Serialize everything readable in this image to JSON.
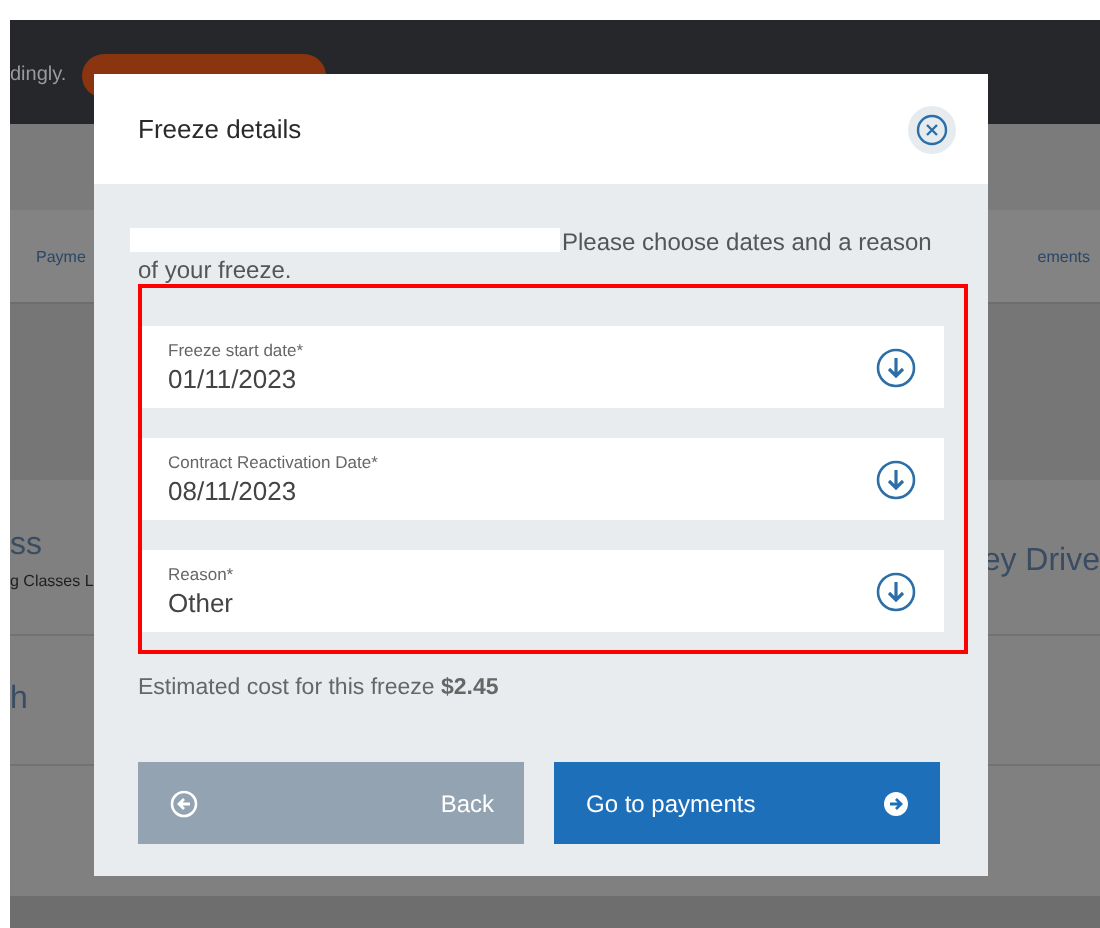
{
  "background": {
    "notice_text": "dingly.",
    "tabs": [
      {
        "label": "Payme"
      },
      {
        "label": "ements"
      }
    ],
    "left_title": "ss",
    "left_subtitle": "g Classes L",
    "right_title": "ey Drive",
    "left_row": "h"
  },
  "dialog": {
    "title": "Freeze details",
    "intro_lines": [
      "Please choose dates and a reason",
      "of your freeze."
    ],
    "fields": [
      {
        "label": "Freeze start date*",
        "value": "01/11/2023"
      },
      {
        "label": "Contract Reactivation Date*",
        "value": "08/11/2023"
      },
      {
        "label": "Reason*",
        "value": "Other"
      }
    ],
    "cost": "Estimated cost for this freeze **$2.45**",
    "buttons": [
      {
        "label": "Back",
        "kind": "back"
      },
      {
        "label": "Go to payments",
        "kind": "forward"
      }
    ]
  }
}
